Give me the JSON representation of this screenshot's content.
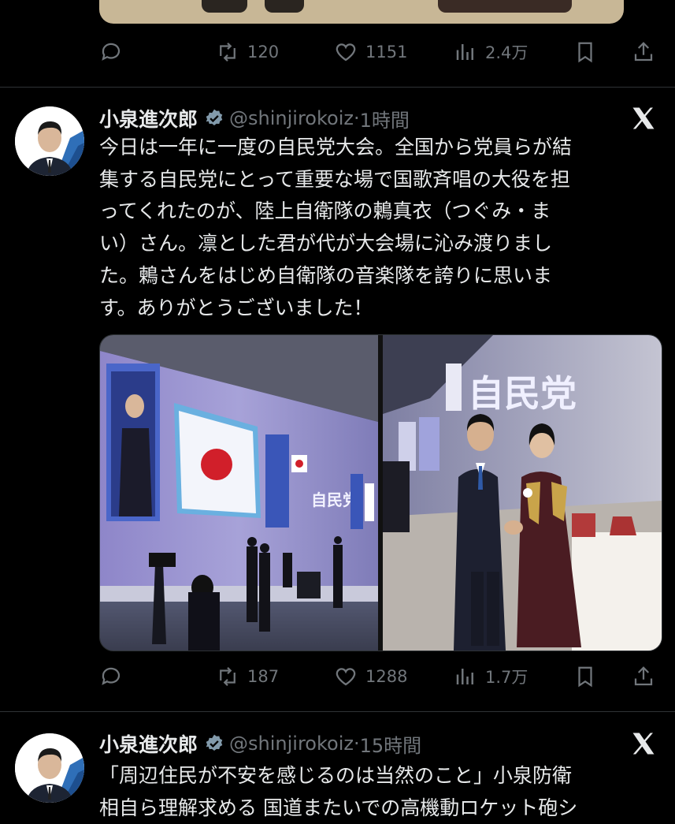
{
  "prev_tweet": {
    "actions": {
      "reposts": "120",
      "likes": "1151",
      "views": "2.4万"
    }
  },
  "tweet1": {
    "author_name": "小泉進次郎",
    "handle": "@shinjirokoiz",
    "time": "1時間",
    "text": "今日は一年に一度の自民党大会。全国から党員らが結\n集する自民党にとって重要な場で国歌斉唱の大役を担\nってくれたのが、陸上自衛隊の鶫真衣（つぐみ・ま\nい）さん。凛とした君が代が大会場に沁み渡りまし\nた。鶫さんをはじめ自衛隊の音楽隊を誇りに思いま\nす。ありがとうございました！",
    "media": {
      "stage_banner": "自民党",
      "photo_banner": "自民党"
    },
    "actions": {
      "reposts": "187",
      "likes": "1288",
      "views": "1.7万"
    }
  },
  "tweet2": {
    "author_name": "小泉進次郎",
    "handle": "@shinjirokoiz",
    "time": "15時間",
    "text": "「周辺住民が不安を感じるのは当然のこと」小泉防衛\n相自ら理解求める 国道またいでの高機動ロケット砲シ"
  },
  "colors": {
    "background": "#000000",
    "text": "#e7e9ea",
    "muted": "#71767b",
    "verified": "#829aab",
    "divider": "#2f3336"
  }
}
